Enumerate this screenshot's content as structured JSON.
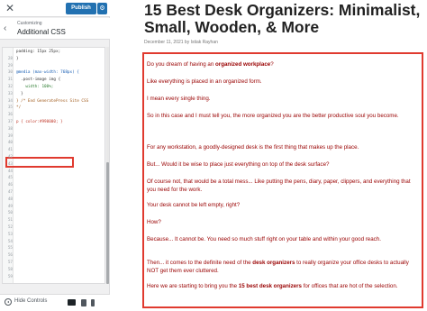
{
  "customizer": {
    "publish_label": "Publish",
    "gear_icon": "gear-icon",
    "close_icon": "close-icon",
    "breadcrumb": "Customizing",
    "section_title": "Additional CSS",
    "hide_controls_label": "Hide Controls",
    "code_lines": [
      {
        "num": "",
        "text": "padding: 15px 25px;"
      },
      {
        "num": "28",
        "text": "}"
      },
      {
        "num": "29",
        "text": ""
      },
      {
        "num": "30",
        "text": "@media (max-width: 768px) {"
      },
      {
        "num": "31",
        "text": "  .post-image img {"
      },
      {
        "num": "32",
        "text": "    width: 100%;"
      },
      {
        "num": "33",
        "text": "  }"
      },
      {
        "num": "34",
        "text": "} /* End GeneratePress Site CSS"
      },
      {
        "num": "35",
        "text": "*/"
      },
      {
        "num": "36",
        "text": ""
      },
      {
        "num": "37",
        "text": "p { color:#990000; }"
      },
      {
        "num": "38",
        "text": ""
      },
      {
        "num": "39",
        "text": ""
      },
      {
        "num": "40",
        "text": ""
      },
      {
        "num": "41",
        "text": ""
      },
      {
        "num": "42",
        "text": ""
      },
      {
        "num": "43",
        "text": ""
      },
      {
        "num": "44",
        "text": ""
      },
      {
        "num": "45",
        "text": ""
      },
      {
        "num": "46",
        "text": ""
      },
      {
        "num": "47",
        "text": ""
      },
      {
        "num": "48",
        "text": ""
      },
      {
        "num": "49",
        "text": ""
      },
      {
        "num": "50",
        "text": ""
      },
      {
        "num": "51",
        "text": ""
      },
      {
        "num": "52",
        "text": ""
      },
      {
        "num": "53",
        "text": ""
      },
      {
        "num": "54",
        "text": ""
      },
      {
        "num": "55",
        "text": ""
      },
      {
        "num": "56",
        "text": ""
      },
      {
        "num": "57",
        "text": ""
      },
      {
        "num": "58",
        "text": ""
      },
      {
        "num": "59",
        "text": ""
      }
    ]
  },
  "preview": {
    "title": "15 Best Desk Organizers: Minimalist, Small, Wooden, & More",
    "meta": "December 11, 2021 by Istiak Rayhan",
    "paragraphs": [
      {
        "before": "Do you dream of having an ",
        "bold": "organized workplace",
        "after": "?"
      },
      {
        "before": "Like everything is placed in an organized form.",
        "bold": "",
        "after": ""
      },
      {
        "before": "I mean every single thing.",
        "bold": "",
        "after": ""
      },
      {
        "before": "So in this case and I must tell you, the more organized you are the better productive soul you become.",
        "bold": "",
        "after": ""
      },
      {
        "before": "For any workstation, a goodly-designed desk is the first thing that makes up the place.",
        "bold": "",
        "after": ""
      },
      {
        "before": "But... Would it be wise to place just everything on top of the desk surface?",
        "bold": "",
        "after": ""
      },
      {
        "before": "Of course not, that would be a total mess... Like putting the pens, diary, paper, clippers, and everything that you need for the work.",
        "bold": "",
        "after": ""
      },
      {
        "before": "Your desk cannot be left empty, right?",
        "bold": "",
        "after": ""
      },
      {
        "before": "How?",
        "bold": "",
        "after": ""
      },
      {
        "before": "Because... It cannot be. You need so much stuff right on your table and within your good reach.",
        "bold": "",
        "after": ""
      },
      {
        "before": "Then... it comes to the definite need of the ",
        "bold": "desk organizers",
        "after": " to really organize your office desks to actually NOT get them ever cluttered."
      },
      {
        "before": "Here we are starting to bring you the ",
        "bold": "15 best desk organizers",
        "after": " for offices that are hot of the selection."
      }
    ]
  }
}
